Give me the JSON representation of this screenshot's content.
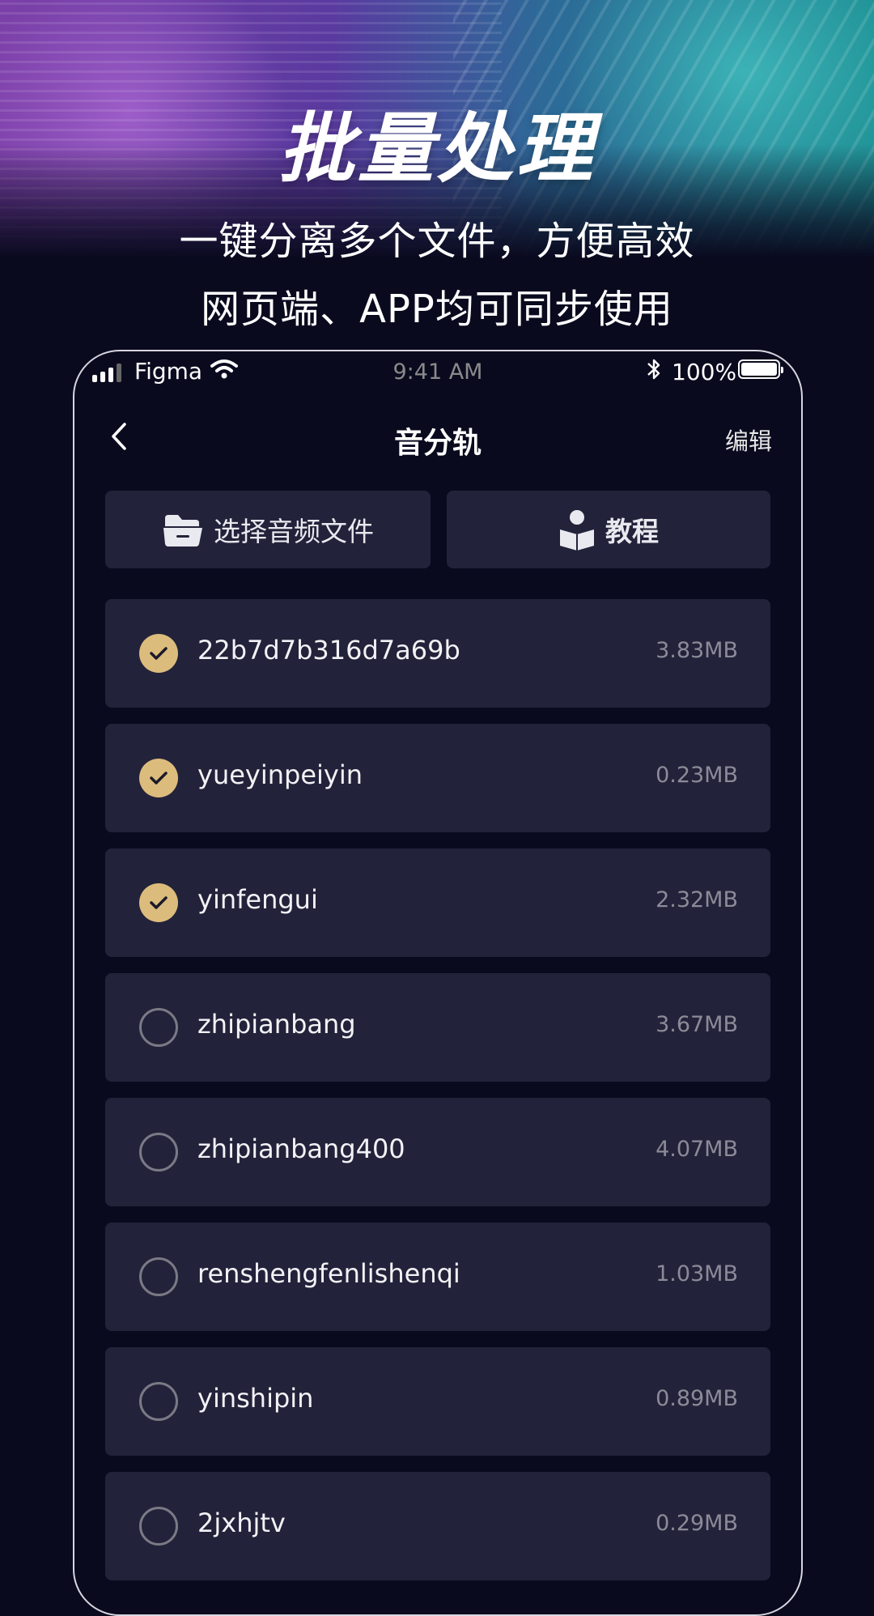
{
  "promo": {
    "title": "批量处理",
    "subtitle_line1": "一键分离多个文件，方便高效",
    "subtitle_line2": "网页端、APP均可同步使用"
  },
  "status_bar": {
    "carrier": "Figma",
    "time": "9:41 AM",
    "battery": "100%",
    "battery_level": 1.0
  },
  "nav": {
    "title": "音分轨",
    "edit_label": "编辑"
  },
  "actions": {
    "select_label": "选择音频文件",
    "tutorial_label": "教程"
  },
  "files": [
    {
      "name": "22b7d7b316d7a69b",
      "size": "3.83MB",
      "checked": true
    },
    {
      "name": "yueyinpeiyin",
      "size": "0.23MB",
      "checked": true
    },
    {
      "name": "yinfengui",
      "size": "2.32MB",
      "checked": true
    },
    {
      "name": "zhipianbang",
      "size": "3.67MB",
      "checked": false
    },
    {
      "name": "zhipianbang400",
      "size": "4.07MB",
      "checked": false
    },
    {
      "name": "renshengfenlishenqi",
      "size": "1.03MB",
      "checked": false
    },
    {
      "name": "yinshipin",
      "size": "0.89MB",
      "checked": false
    },
    {
      "name": "2jxhjtv",
      "size": "0.29MB",
      "checked": false
    }
  ],
  "colors": {
    "background": "#0a0a1f",
    "card": "#22223a",
    "accent_gold": "#dcbc7c"
  }
}
